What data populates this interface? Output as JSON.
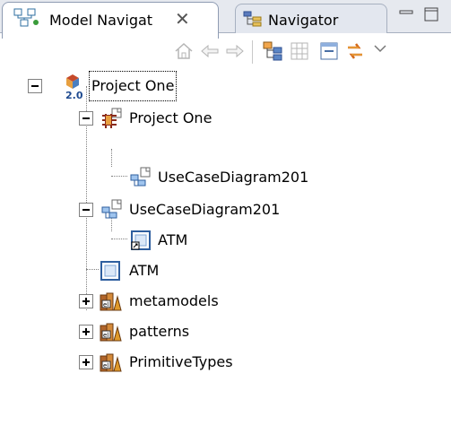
{
  "tabs": [
    {
      "label": "Model Navigat",
      "icon": "model-navigator-icon",
      "active": true
    },
    {
      "label": "Navigator",
      "icon": "navigator-icon",
      "active": false
    }
  ],
  "toolbar": {
    "items": [
      "home-icon",
      "back-arrow-icon",
      "forward-arrow-icon",
      "link-editor-icon",
      "new-diagram-icon",
      "collapse-all-icon",
      "sync-icon",
      "view-menu-icon"
    ]
  },
  "tree": [
    {
      "label": "Project One",
      "icon": "project-icon",
      "version_badge": "2.0",
      "expander": "minus",
      "selected": true
    },
    {
      "label": "Project One",
      "icon": "package-icon",
      "expander": "minus"
    },
    {
      "label": "UseCaseDiagram201",
      "icon": "usecase-diagram-icon",
      "expander": "none"
    },
    {
      "label": "UseCaseDiagram201",
      "icon": "usecase-diagram-icon",
      "expander": "minus"
    },
    {
      "label": "ATM",
      "icon": "diagram-shortcut-icon",
      "expander": "none"
    },
    {
      "label": "ATM",
      "icon": "subsystem-icon",
      "expander": "none"
    },
    {
      "label": "metamodels",
      "icon": "library-icon",
      "expander": "plus"
    },
    {
      "label": "patterns",
      "icon": "library-icon",
      "expander": "plus"
    },
    {
      "label": "PrimitiveTypes",
      "icon": "library-icon",
      "expander": "plus"
    }
  ],
  "colors": {
    "accent": "#d46a1c",
    "tab_border": "#8f9cb3"
  }
}
